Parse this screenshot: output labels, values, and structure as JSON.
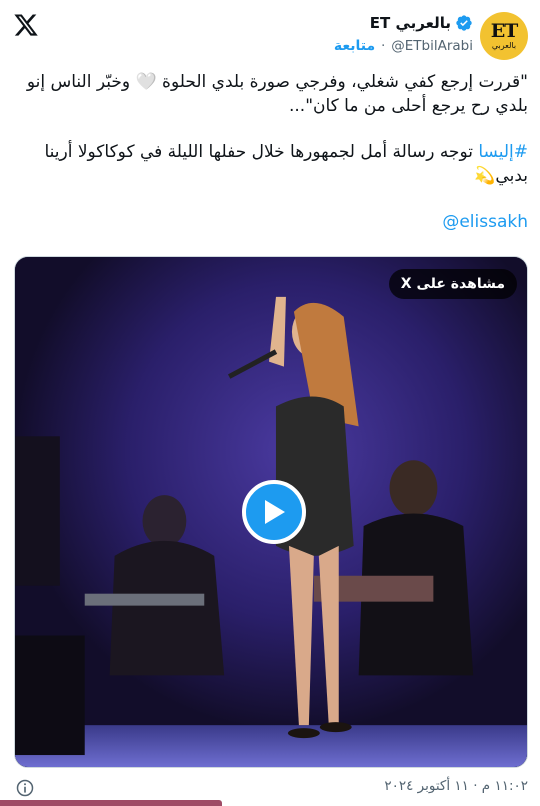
{
  "header": {
    "display_name": "بالعربي ET",
    "handle": "@ETbilArabi",
    "separator": "·",
    "follow_label": "متابعة",
    "avatar_logo_text": "ET",
    "avatar_logo_sub": "بالعربي",
    "verified_icon": "verified-badge-icon",
    "platform_icon": "x-logo-icon"
  },
  "tweet": {
    "quote_line": "\"قررت إرجع كفي شغلي، وفرجي صورة بلدي الحلوة 🤍 وخبّر الناس إنو بلدي رح يرجع أحلى من ما كان\"...",
    "hashtag": "#إليسا",
    "body_rest": " توجه رسالة أمل لجمهورها خلال حفلها الليلة في كوكاكولا أرينا بدبي💫",
    "mention": "@elissakh"
  },
  "media": {
    "watch_label": "مشاهدة على X",
    "play_icon": "play-icon"
  },
  "footer": {
    "timestamp": "١١:٠٢ م · ١١ أكتوبر ٢٠٢٤",
    "info_icon": "info-icon"
  },
  "colors": {
    "accent": "#1d9bf0",
    "text": "#0f1419",
    "muted": "#536471",
    "avatar_bg": "#f2c230",
    "stage_bg": "#1a1436"
  }
}
